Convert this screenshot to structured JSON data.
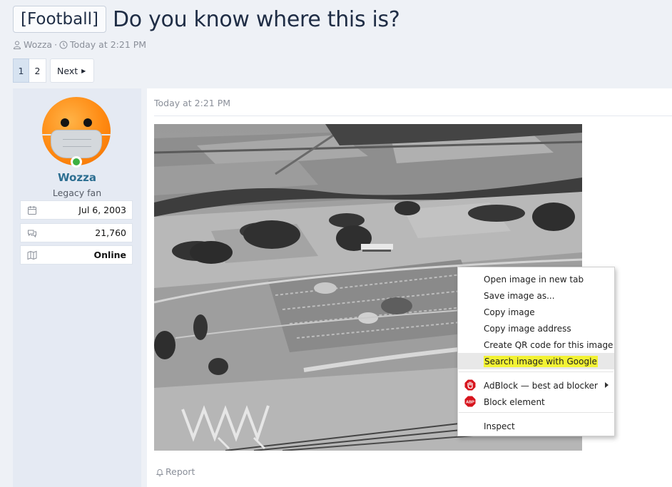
{
  "thread": {
    "prefix": "[Football]",
    "title": "Do you know where this is?",
    "author": "Wozza",
    "separator": "·",
    "time": "Today at 2:21 PM"
  },
  "pagination": {
    "pages": [
      "1",
      "2"
    ],
    "current_page": "1",
    "next_label": "Next"
  },
  "user": {
    "name": "Wozza",
    "title": "Legacy fan",
    "joined": "Jul 6, 2003",
    "messages": "21,760",
    "location": "Online",
    "online": true
  },
  "post": {
    "date": "Today at 2:21 PM",
    "report_label": "Report",
    "image_icon": "aerial-photo"
  },
  "context_menu": {
    "items": [
      "Open image in new tab",
      "Save image as...",
      "Copy image",
      "Copy image address",
      "Create QR code for this image",
      "Search image with Google",
      "AdBlock — best ad blocker",
      "Block element",
      "Inspect"
    ],
    "abp_badge": "ABP",
    "highlighted_item": "Search image with Google"
  },
  "colors": {
    "accent": "#2c6e91",
    "title": "#1f2d45",
    "online": "#3cb043",
    "adblock_red": "#d7141d",
    "highlight": "#f2f233"
  }
}
